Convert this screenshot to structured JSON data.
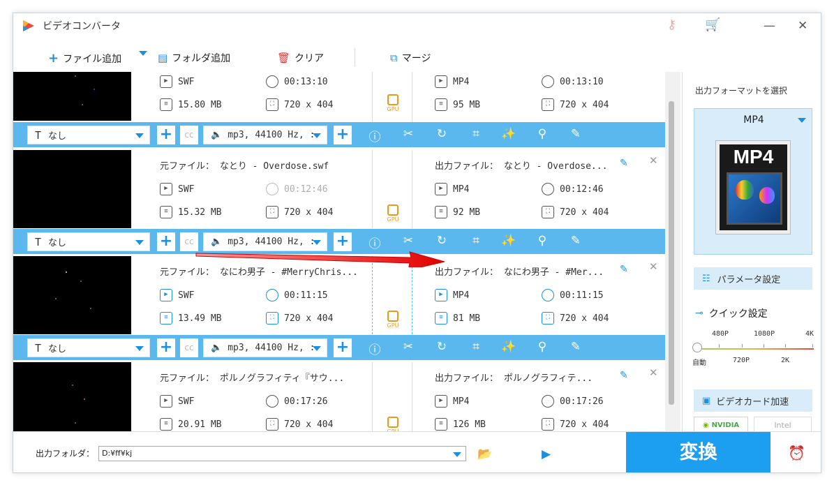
{
  "app": {
    "title": "ビデオコンバータ"
  },
  "toolbar": {
    "add_file": "ファイル追加",
    "add_folder": "フォルダ追加",
    "clear": "クリア",
    "merge": "マージ"
  },
  "items": [
    {
      "src_name": "",
      "dst_name": "",
      "src_format": "SWF",
      "src_duration": "00:13:10",
      "src_size": "15.80 MB",
      "src_res": "720 x 404",
      "dst_format": "MP4",
      "dst_duration": "00:13:10",
      "dst_size": "95 MB",
      "dst_res": "720 x 404",
      "subtitle": "なし",
      "audio": "mp3, 44100 Hz, :"
    },
    {
      "src_name": "元ファイル： なとり - Overdose.swf",
      "dst_name": "出力ファイル： なとり - Overdose...",
      "src_format": "SWF",
      "src_duration": "00:12:46",
      "src_size": "15.32 MB",
      "src_res": "720 x 404",
      "dst_format": "MP4",
      "dst_duration": "00:12:46",
      "dst_size": "92 MB",
      "dst_res": "720 x 404",
      "subtitle": "なし",
      "audio": "mp3, 44100 Hz, :"
    },
    {
      "src_name": "元ファイル： なにわ男子 - #MerryChris...",
      "dst_name": "出力ファイル： なにわ男子 - #Mer...",
      "src_format": "SWF",
      "src_duration": "00:11:15",
      "src_size": "13.49 MB",
      "src_res": "720 x 404",
      "dst_format": "MP4",
      "dst_duration": "00:11:15",
      "dst_size": "81 MB",
      "dst_res": "720 x 404",
      "subtitle": "なし",
      "audio": "mp3, 44100 Hz, :"
    },
    {
      "src_name": "元ファイル： ポルノグラフィティ『サウ...",
      "dst_name": "出力ファイル： ポルノグラフィテ...",
      "src_format": "SWF",
      "src_duration": "00:17:26",
      "src_size": "20.91 MB",
      "src_res": "720 x 404",
      "dst_format": "MP4",
      "dst_duration": "00:17:26",
      "dst_size": "126 MB",
      "dst_res": "720 x 404"
    }
  ],
  "gpu_label": "GPU",
  "right_panel": {
    "title": "出力フォーマットを選択",
    "format": "MP4",
    "format_icon_text": "MP4",
    "param_button": "パラメータ設定",
    "quick_title": "クイック設定",
    "slider_top": [
      "480P",
      "1080P",
      "4K"
    ],
    "slider_bottom": [
      "自動",
      "720P",
      "2K"
    ],
    "quality_level": 0,
    "gpu_button": "ビデオカード加速",
    "nvidia": "NVIDIA",
    "intel": "Intel"
  },
  "bottom": {
    "output_label": "出力フォルダ：",
    "output_path": "D:¥ff¥kj",
    "convert": "変換"
  }
}
